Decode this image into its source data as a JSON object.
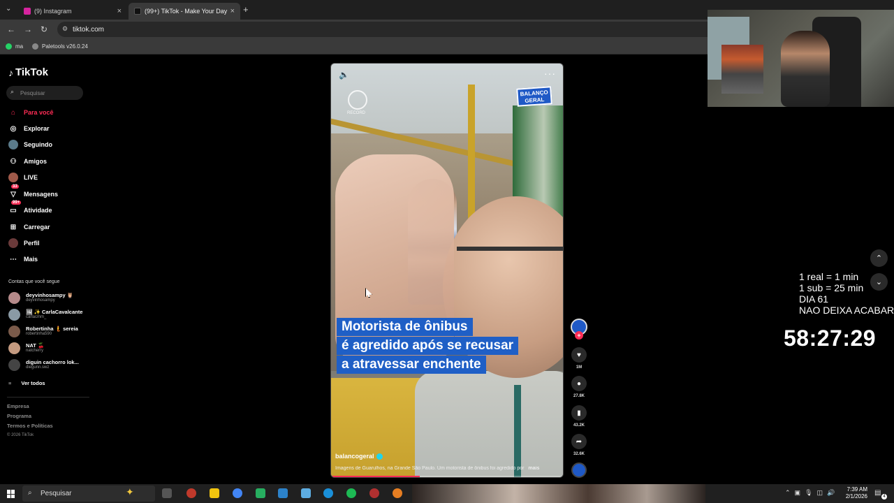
{
  "browser": {
    "tabs": [
      {
        "label": "(9) Instagram",
        "color": "#d6249f"
      },
      {
        "label": "(99+) TikTok - Make Your Day",
        "color": "#000000"
      }
    ],
    "url": "tiktok.com",
    "bookmarks": [
      {
        "label": "ma",
        "color": "#25d366"
      },
      {
        "label": "Paletools v26.0.24",
        "color": "#888888"
      }
    ]
  },
  "sidebar": {
    "logo": "TikTok",
    "search_placeholder": "Pesquisar",
    "nav": [
      {
        "label": "Para você",
        "icon": "home-icon"
      },
      {
        "label": "Explorar",
        "icon": "compass-icon"
      },
      {
        "label": "Seguindo",
        "icon": "following-avatar-icon"
      },
      {
        "label": "Amigos",
        "icon": "friends-icon"
      },
      {
        "label": "LIVE",
        "icon": "live-icon"
      },
      {
        "label": "Mensagens",
        "icon": "messages-icon",
        "badge": "33"
      },
      {
        "label": "Atividade",
        "icon": "activity-icon",
        "badge": "99+"
      },
      {
        "label": "Carregar",
        "icon": "upload-icon"
      },
      {
        "label": "Perfil",
        "icon": "profile-icon"
      },
      {
        "label": "Mais",
        "icon": "more-icon"
      }
    ],
    "following_title": "Contas que você segue",
    "following": [
      {
        "name": "deyvinhosampy 🦉",
        "handle": "deyvinhosampy"
      },
      {
        "name": "🖼 ✨ CarlaCavalcante",
        "handle": "carlacmm_"
      },
      {
        "name": "Robertinha 🧜 sereia",
        "handle": "robertinha590"
      },
      {
        "name": "NAT 🍒",
        "handle": "natcherry"
      },
      {
        "name": "diguin cachorro lok...",
        "handle": "diegunn.swz"
      }
    ],
    "see_all": "Ver todos",
    "footer": [
      "Empresa",
      "Programa",
      "Termos e Políticas"
    ],
    "copyright": "© 2026 TikTok"
  },
  "video": {
    "channel_logo": "BALANÇO GERAL",
    "record_logo": "RECORD",
    "headline": [
      "Motorista de ônibus",
      "é agredido após se recusar",
      "a atravessar enchente"
    ],
    "author": "balancogeral",
    "caption": "Imagens de Guarulhos, na Grande São Paulo. Um motorista de ônibus foi agredido por",
    "caption_more": "mais",
    "progress": 0.38
  },
  "actions": {
    "likes": "1M",
    "comments": "27.8K",
    "saves": "43.2K",
    "shares": "32.6K"
  },
  "overlay": {
    "lines": [
      "1 real = 1 min",
      "1 sub = 25 min",
      "DIA 61",
      "NAO DEIXA ACABAR"
    ],
    "timer": "58:27:29"
  },
  "taskbar": {
    "search": "Pesquisar",
    "time": "7:39 AM",
    "date": "2/1/2026",
    "notifications": "4"
  }
}
